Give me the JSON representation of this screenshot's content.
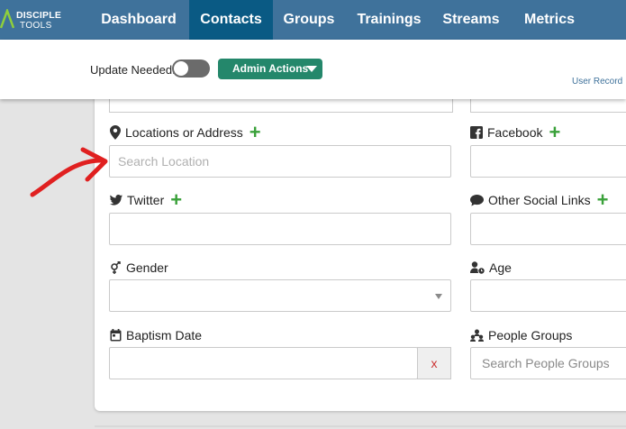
{
  "logo": {
    "line1": "DISCIPLE",
    "line2": "TOOLS"
  },
  "nav": [
    {
      "label": "Dashboard"
    },
    {
      "label": "Contacts"
    },
    {
      "label": "Groups"
    },
    {
      "label": "Trainings"
    },
    {
      "label": "Streams"
    },
    {
      "label": "Metrics"
    }
  ],
  "active_nav": "Contacts",
  "subheader": {
    "update_label": "Update Needed:",
    "admin_actions": "Admin Actions",
    "user_record": "User Record"
  },
  "fields": {
    "locations": {
      "label": "Locations or Address",
      "placeholder": "Search Location"
    },
    "facebook": {
      "label": "Facebook"
    },
    "twitter": {
      "label": "Twitter"
    },
    "other_social": {
      "label": "Other Social Links"
    },
    "gender": {
      "label": "Gender"
    },
    "age": {
      "label": "Age"
    },
    "baptism_date": {
      "label": "Baptism Date",
      "clear": "x"
    },
    "people_groups": {
      "label": "People Groups",
      "placeholder": "Search People Groups"
    }
  },
  "colors": {
    "nav_bg": "#3f729b",
    "nav_active": "#0a5a84",
    "admin_button": "#24876b",
    "plus": "#3aa13a",
    "annotation_arrow": "#e02020"
  },
  "icons": [
    "disciple-tools-logo",
    "location-pin-icon",
    "facebook-icon",
    "twitter-icon",
    "speech-bubble-icon",
    "gender-icon",
    "person-clock-icon",
    "calendar-icon",
    "people-group-icon",
    "chevron-down-icon"
  ]
}
